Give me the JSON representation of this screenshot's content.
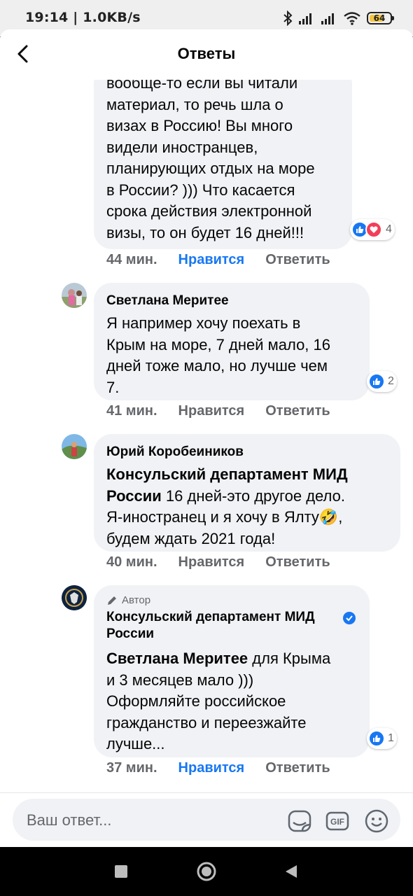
{
  "status": {
    "time": "19:14 | 1.0KB/s",
    "battery": "64"
  },
  "header": {
    "title": "Ответы"
  },
  "comments": [
    {
      "text": "вообще-то если вы читали\nматериал, то речь шла о\nвизах в Россию! Вы много\nвидели иностранцев,\nпланирующих отдых на море\nв России? ))) Что касается\nсрока действия электронной\nвизы, то он будет 16 дней!!!",
      "time": "44 мин.",
      "like": "Нравится",
      "reply": "Ответить",
      "reactions": "4"
    },
    {
      "author": "Светлана Меритее",
      "text": "Я например хочу поехать в\nКрым на море, 7 дней мало, 16\nдней тоже мало, но лучше чем\n7.",
      "time": "41 мин.",
      "like": "Нравится",
      "reply": "Ответить",
      "reactions": "2"
    },
    {
      "author": "Юрий Коробеиников",
      "tag": "Консульский департамент МИД\nРоссии",
      "text": " 16 дней-это другое дело.\nЯ-иностранец и я хочу в Ялту🤣,\nбудем ждать 2021 года!",
      "time": "40 мин.",
      "like": "Нравится",
      "reply": "Ответить"
    },
    {
      "badge": "Автор",
      "author": "Консульский департамент МИД\nРоссии",
      "tag": "Светлана Меритее",
      "text": " для Крыма\nи 3 месяцев мало )))\nОформляйте российское\nгражданство и переезжайте\nлучше...",
      "time": "37 мин.",
      "like": "Нравится",
      "reply": "Ответить",
      "reactions": "1"
    }
  ],
  "composer": {
    "placeholder": "Ваш ответ..."
  },
  "colors": {
    "accent": "#1877f2",
    "bubble": "#f0f2f5",
    "muted": "#65676b"
  },
  "icons": [
    "back-arrow-icon",
    "sticker-icon",
    "gif-icon",
    "emoji-icon",
    "like-reaction-icon",
    "love-reaction-icon",
    "verified-icon",
    "pencil-icon"
  ]
}
